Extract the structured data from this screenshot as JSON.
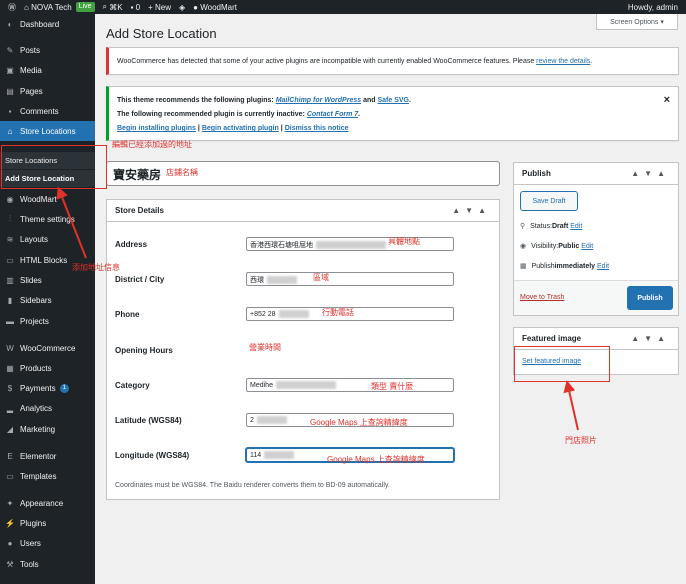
{
  "adminbar": {
    "site": "NOVA Tech",
    "live": "Live",
    "shortcut": "⌘K",
    "comments": "0",
    "new": "New",
    "woodmart": "WoodMart",
    "howdy": "Howdy, admin"
  },
  "sidebar": {
    "items": [
      {
        "label": "Dashboard",
        "icon": "dashboard-icon"
      },
      {
        "label": "Posts",
        "icon": "pin-icon"
      },
      {
        "label": "Media",
        "icon": "media-icon"
      },
      {
        "label": "Pages",
        "icon": "page-icon"
      },
      {
        "label": "Comments",
        "icon": "comment-icon"
      },
      {
        "label": "Store Locations",
        "icon": "store-icon"
      },
      {
        "label": "WoodMart",
        "icon": "woodmart-icon"
      },
      {
        "label": "Theme settings",
        "icon": "sliders-icon"
      },
      {
        "label": "Layouts",
        "icon": "layers-icon"
      },
      {
        "label": "HTML Blocks",
        "icon": "html-icon"
      },
      {
        "label": "Slides",
        "icon": "slides-icon"
      },
      {
        "label": "Sidebars",
        "icon": "sidebar-icon"
      },
      {
        "label": "Projects",
        "icon": "briefcase-icon"
      },
      {
        "label": "WooCommerce",
        "icon": "woo-icon"
      },
      {
        "label": "Products",
        "icon": "archive-icon"
      },
      {
        "label": "Payments",
        "icon": "payments-icon",
        "badge": "1"
      },
      {
        "label": "Analytics",
        "icon": "bar-chart-icon"
      },
      {
        "label": "Marketing",
        "icon": "megaphone-icon"
      },
      {
        "label": "Elementor",
        "icon": "elementor-icon"
      },
      {
        "label": "Templates",
        "icon": "folder-icon"
      },
      {
        "label": "Appearance",
        "icon": "brush-icon"
      },
      {
        "label": "Plugins",
        "icon": "plug-icon"
      },
      {
        "label": "Users",
        "icon": "user-icon"
      },
      {
        "label": "Tools",
        "icon": "wrench-icon"
      }
    ],
    "sub": [
      "Store Locations",
      "Add Store Location"
    ]
  },
  "screen_options": "Screen Options ▾",
  "page_title": "Add Store Location",
  "notice_woo": {
    "text": "WooCommerce has detected that some of your active plugins are incompatible with currently enabled WooCommerce features. Please ",
    "link": "review the details",
    "end": "."
  },
  "notice_theme": {
    "line1_a": "This theme recommends the following plugins: ",
    "line1_l1": "MailChimp for WordPress",
    "line1_and": " and ",
    "line1_l2": "Safe SVG",
    "line1_end": ".",
    "line2_a": "The following recommended plugin is currently inactive: ",
    "line2_l": "Contact Form 7",
    "line2_end": ".",
    "link1": "Begin installing plugins",
    "sep": " | ",
    "link2": "Begin activating plugin",
    "link3": "Dismiss this notice",
    "dismiss": "×"
  },
  "title_input": "寶安藥房",
  "details": {
    "header": "Store Details",
    "rows": [
      {
        "label": "Address",
        "value": "香港西環石塘咀屈地"
      },
      {
        "label": "District / City",
        "value": "西環"
      },
      {
        "label": "Phone",
        "value": "+852 28"
      },
      {
        "label": "Opening Hours",
        "value": ""
      },
      {
        "label": "Category",
        "value": "Medihe"
      },
      {
        "label": "Latitude (WGS84)",
        "value": "2"
      },
      {
        "label": "Longitude (WGS84)",
        "value": "114"
      }
    ],
    "note": "Coordinates must be WGS84. The Baidu renderer converts them to BD-09 automatically."
  },
  "publish": {
    "header": "Publish",
    "save_draft": "Save Draft",
    "status_label": "Status: ",
    "status_value": "Draft",
    "visibility_label": "Visibility: ",
    "visibility_value": "Public",
    "immediately_label": "Publish ",
    "immediately_value": "immediately",
    "edit": "Edit",
    "trash": "Move to Trash",
    "publish": "Publish"
  },
  "featured": {
    "header": "Featured image",
    "link": "Set featured image"
  },
  "annotations": {
    "edit_added": "編輯已經添加過的地址",
    "store_name": "店鋪名稱",
    "add_info": "添加地址信息",
    "address_detail": "具體地點",
    "district": "區域",
    "mobile": "行動電話",
    "hours": "營業時間",
    "category": "類型 賣什麼",
    "gmaps_lat": "Google Maps 上查詢精緯度",
    "gmaps_lng": "Google Maps 上查詢精緯度",
    "shop_photo": "門店照片"
  },
  "colors": {
    "accent": "#2271b1",
    "annotation": "#e0312b",
    "sidebar": "#1d2327"
  }
}
